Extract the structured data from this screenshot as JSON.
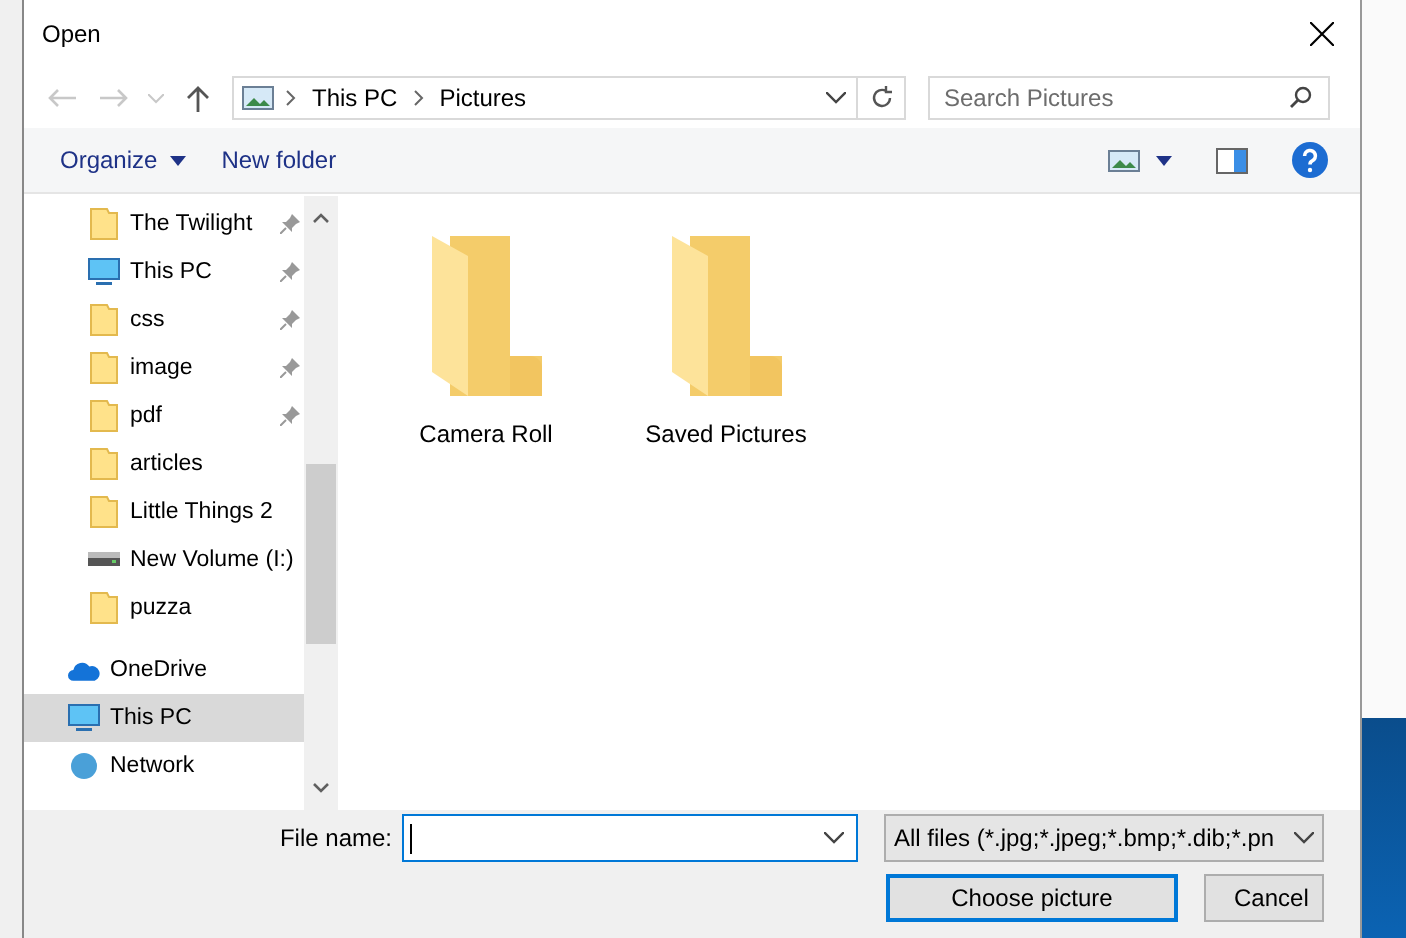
{
  "window": {
    "title": "Open"
  },
  "navigation": {
    "path": [
      "This PC",
      "Pictures"
    ],
    "search": {
      "placeholder": "Search Pictures"
    }
  },
  "toolbar": {
    "organize": "Organize",
    "new_folder": "New folder"
  },
  "sidebar": {
    "items": [
      {
        "label": "The Twilight",
        "kind": "folder",
        "pinned": true,
        "selected": false
      },
      {
        "label": "This PC",
        "kind": "pc",
        "pinned": true,
        "selected": false
      },
      {
        "label": "css",
        "kind": "folder",
        "pinned": true,
        "selected": false
      },
      {
        "label": "image",
        "kind": "folder",
        "pinned": true,
        "selected": false
      },
      {
        "label": "pdf",
        "kind": "folder",
        "pinned": true,
        "selected": false
      },
      {
        "label": "articles",
        "kind": "folder",
        "pinned": false,
        "selected": false
      },
      {
        "label": "Little Things 2",
        "kind": "folder",
        "pinned": false,
        "selected": false
      },
      {
        "label": "New Volume (I:)",
        "kind": "drive",
        "pinned": false,
        "selected": false
      },
      {
        "label": "puzza",
        "kind": "folder",
        "pinned": false,
        "selected": false
      },
      {
        "label": "OneDrive",
        "kind": "cloud",
        "pinned": false,
        "selected": false
      },
      {
        "label": "This PC",
        "kind": "pc",
        "pinned": false,
        "selected": true
      },
      {
        "label": "Network",
        "kind": "network",
        "pinned": false,
        "selected": false
      }
    ]
  },
  "folders": [
    {
      "name": "Camera Roll"
    },
    {
      "name": "Saved Pictures"
    }
  ],
  "footer": {
    "file_name_label": "File name:",
    "file_name": {
      "focused": true
    },
    "filter": "All files (*.jpg;*.jpeg;*.bmp;*.dib;*.pn",
    "buttons": [
      {
        "label": "Choose picture",
        "default": true
      },
      {
        "label": "Cancel",
        "default": false
      }
    ]
  }
}
